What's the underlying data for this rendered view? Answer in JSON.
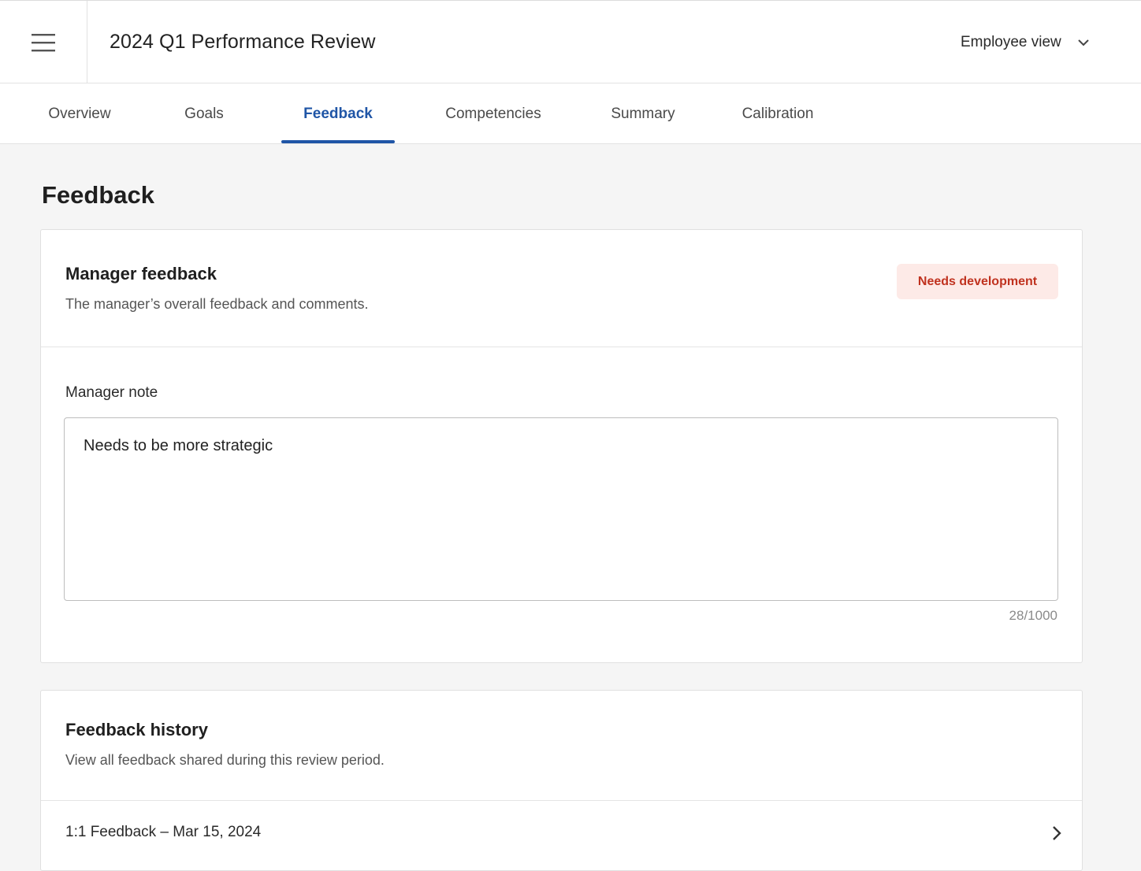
{
  "header": {
    "title": "2024 Q1 Performance Review",
    "view_selector": "Employee view",
    "icons": {
      "menu": "hamburger-menu-icon",
      "dropdown": "chevron-down-icon"
    }
  },
  "tabs": [
    {
      "label": "Overview",
      "active": false
    },
    {
      "label": "Goals",
      "active": false
    },
    {
      "label": "Feedback",
      "active": true
    },
    {
      "label": "Competencies",
      "active": false
    },
    {
      "label": "Summary",
      "active": false
    },
    {
      "label": "Calibration",
      "active": false
    }
  ],
  "page": {
    "title": "Feedback"
  },
  "manager_feedback": {
    "title": "Manager feedback",
    "subtitle": "The manager’s overall feedback and comments.",
    "status_badge": "Needs development",
    "note_label": "Manager note",
    "note_value": "Needs to be more strategic",
    "char_count": "28/1000"
  },
  "feedback_history": {
    "title": "Feedback history",
    "subtitle": "View all feedback shared during this review period.",
    "items": [
      {
        "label": "1:1 Feedback – Mar 15, 2024"
      }
    ]
  },
  "colors": {
    "accent": "#1f55a6",
    "badge_bg": "#fdeae7",
    "badge_text": "#c0321f",
    "background": "#f5f5f5"
  }
}
